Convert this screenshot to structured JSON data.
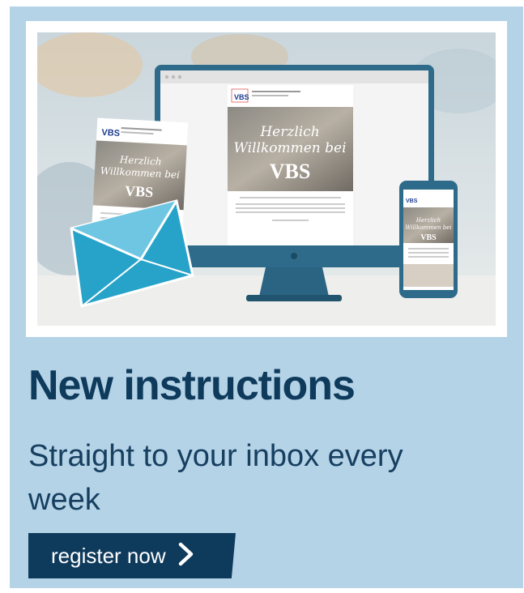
{
  "promo": {
    "headline": "New instructions",
    "subline": "Straight to your inbox every week",
    "cta_label": "register now"
  },
  "illustration": {
    "brand_logo_text": "VBS",
    "greeting_line_1": "Herzlich",
    "greeting_line_2": "Willkommen bei"
  },
  "colors": {
    "card_background": "#b5d3e7",
    "headline": "#0e3a5c",
    "button": "#0e3a5c",
    "envelope": "#27a3c9",
    "monitor": "#2e6b8a"
  },
  "icons": {
    "cta_icon": "chevron-right-icon"
  }
}
